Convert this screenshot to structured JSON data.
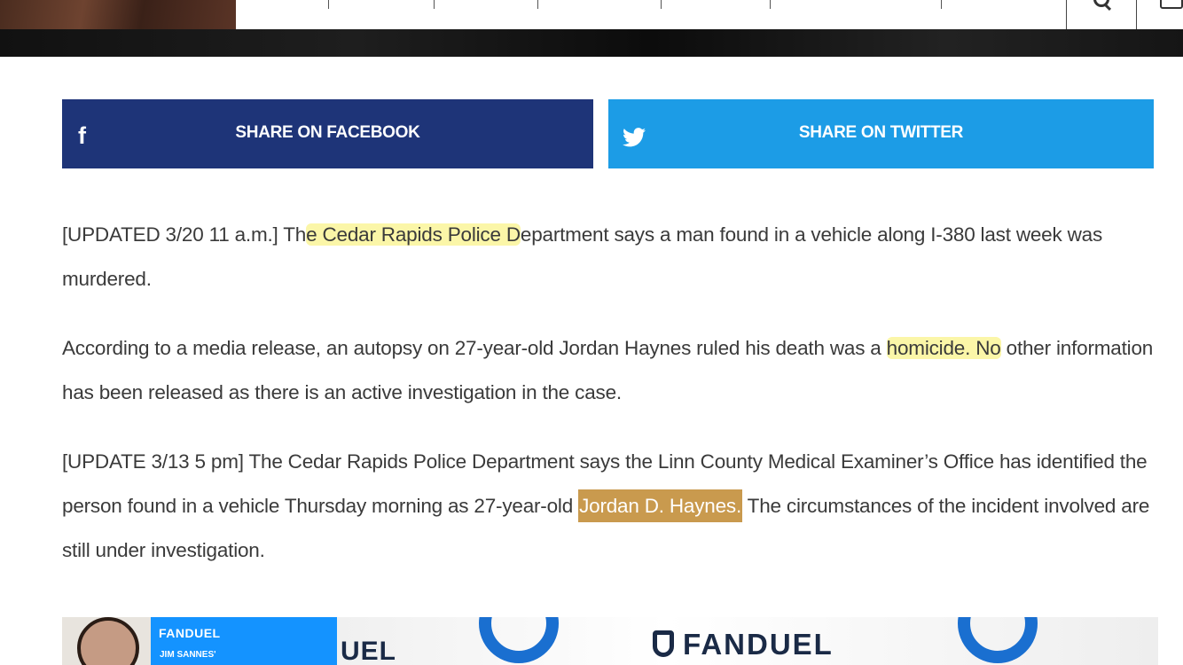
{
  "share": {
    "facebook_label": "SHARE ON FACEBOOK",
    "facebook_icon": "f",
    "twitter_label": "SHARE ON TWITTER",
    "facebook_color": "#1e3478",
    "twitter_color": "#1c9ce6"
  },
  "article": {
    "p1": {
      "a": "[UPDATED 3/20 11 a.m.] Th",
      "hl": "e Cedar Rapids Police D",
      "b": "epartment says a man found in a vehicle along I-380 last week was murdered."
    },
    "p2": {
      "a": "According to a media release, an autopsy on 27-year-old Jordan Haynes ruled his death was a ",
      "hl": "homicide. No",
      "b": " other information has been released as there is an active investigation in the case."
    },
    "p3": {
      "a": "[UPDATE 3/13 5 pm] The Cedar Rapids Police Department says the Linn County Medical Examiner’s Office has identified the person found in a vehicle Thursday morning as 27-year-old ",
      "hl": "Jordan D. Haynes.",
      "b": " The circumstances of the incident involved are still under investigation."
    }
  },
  "ad": {
    "brand": "FANDUEL",
    "person": "JIM SANNES'",
    "fragment": "UEL",
    "main_logo": "FANDUEL",
    "brand_color": "#1493ff"
  },
  "colors": {
    "highlight_yellow": "#fbf6a8",
    "highlight_gold": "#c99a4e"
  }
}
